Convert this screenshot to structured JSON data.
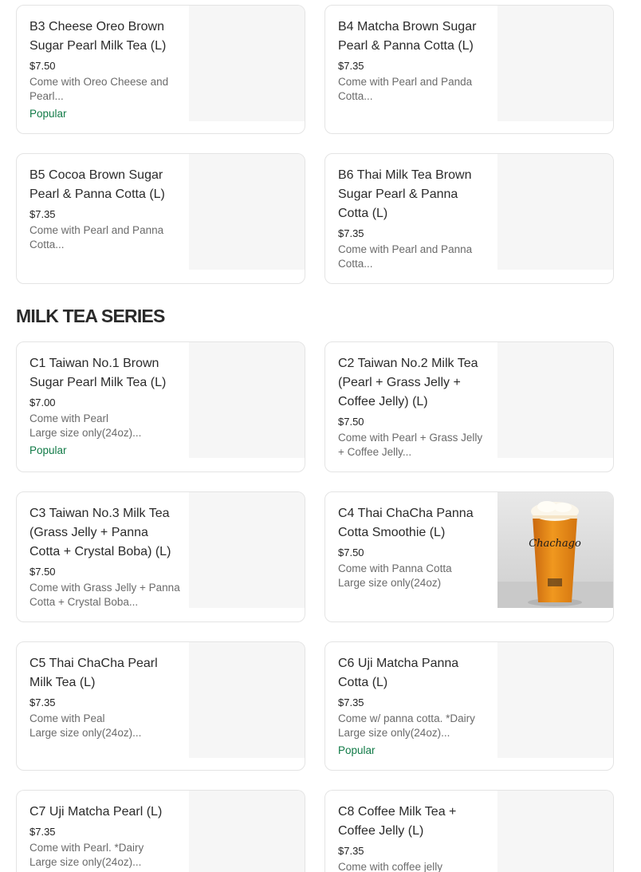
{
  "section": {
    "title": "MILK TEA SERIES"
  },
  "items": [
    {
      "name": "B3 Cheese Oreo Brown Sugar Pearl Milk Tea (L)",
      "price": "$7.50",
      "description": "Come with Oreo Cheese and Pearl...",
      "badge": "Popular"
    },
    {
      "name": "B4 Matcha Brown Sugar Pearl & Panna Cotta (L)",
      "price": "$7.35",
      "description": "Come with Pearl and Panda Cotta...",
      "badge": ""
    },
    {
      "name": "B5 Cocoa Brown Sugar Pearl & Panna Cotta (L)",
      "price": "$7.35",
      "description": "Come with Pearl and Panna Cotta...",
      "badge": ""
    },
    {
      "name": "B6 Thai Milk Tea Brown Sugar Pearl & Panna Cotta (L)",
      "price": "$7.35",
      "description": "Come with Pearl and Panna Cotta...",
      "badge": ""
    },
    {
      "name": "C1 Taiwan No.1 Brown Sugar Pearl Milk Tea (L)",
      "price": "$7.00",
      "description": "Come with Pearl\nLarge size only(24oz)...",
      "badge": "Popular"
    },
    {
      "name": "C2 Taiwan No.2 Milk Tea (Pearl + Grass Jelly + Coffee Jelly)  (L)",
      "price": "$7.50",
      "description": "Come with Pearl + Grass Jelly + Coffee Jelly...",
      "badge": ""
    },
    {
      "name": "C3 Taiwan No.3 Milk Tea (Grass Jelly + Panna Cotta + Crystal Boba) (L)",
      "price": "$7.50",
      "description": "Come with Grass Jelly + Panna Cotta + Crystal Boba...",
      "badge": ""
    },
    {
      "name": "C4 Thai ChaCha Panna Cotta Smoothie (L)",
      "price": "$7.50",
      "description": "Come with Panna Cotta\nLarge size only(24oz)",
      "badge": "",
      "image_text": "Chachago"
    },
    {
      "name": "C5 Thai ChaCha Pearl Milk Tea (L)",
      "price": "$7.35",
      "description": "Come with Peal\nLarge size only(24oz)...",
      "badge": ""
    },
    {
      "name": "C6 Uji Matcha Panna Cotta (L)",
      "price": "$7.35",
      "description": "Come w/ panna cotta. *Dairy\nLarge size only(24oz)...",
      "badge": "Popular"
    },
    {
      "name": "C7 Uji Matcha Pearl (L)",
      "price": "$7.35",
      "description": "Come with Pearl. *Dairy\nLarge size only(24oz)...",
      "badge": ""
    },
    {
      "name": "C8 Coffee Milk Tea + Coffee Jelly (L)",
      "price": "$7.35",
      "description": "Come with coffee jelly",
      "badge": ""
    }
  ],
  "colors": {
    "popular": "#117a47",
    "border": "#e4e4e4",
    "thumb_placeholder": "#f6f6f6",
    "drink_orange": "#e8891f"
  }
}
